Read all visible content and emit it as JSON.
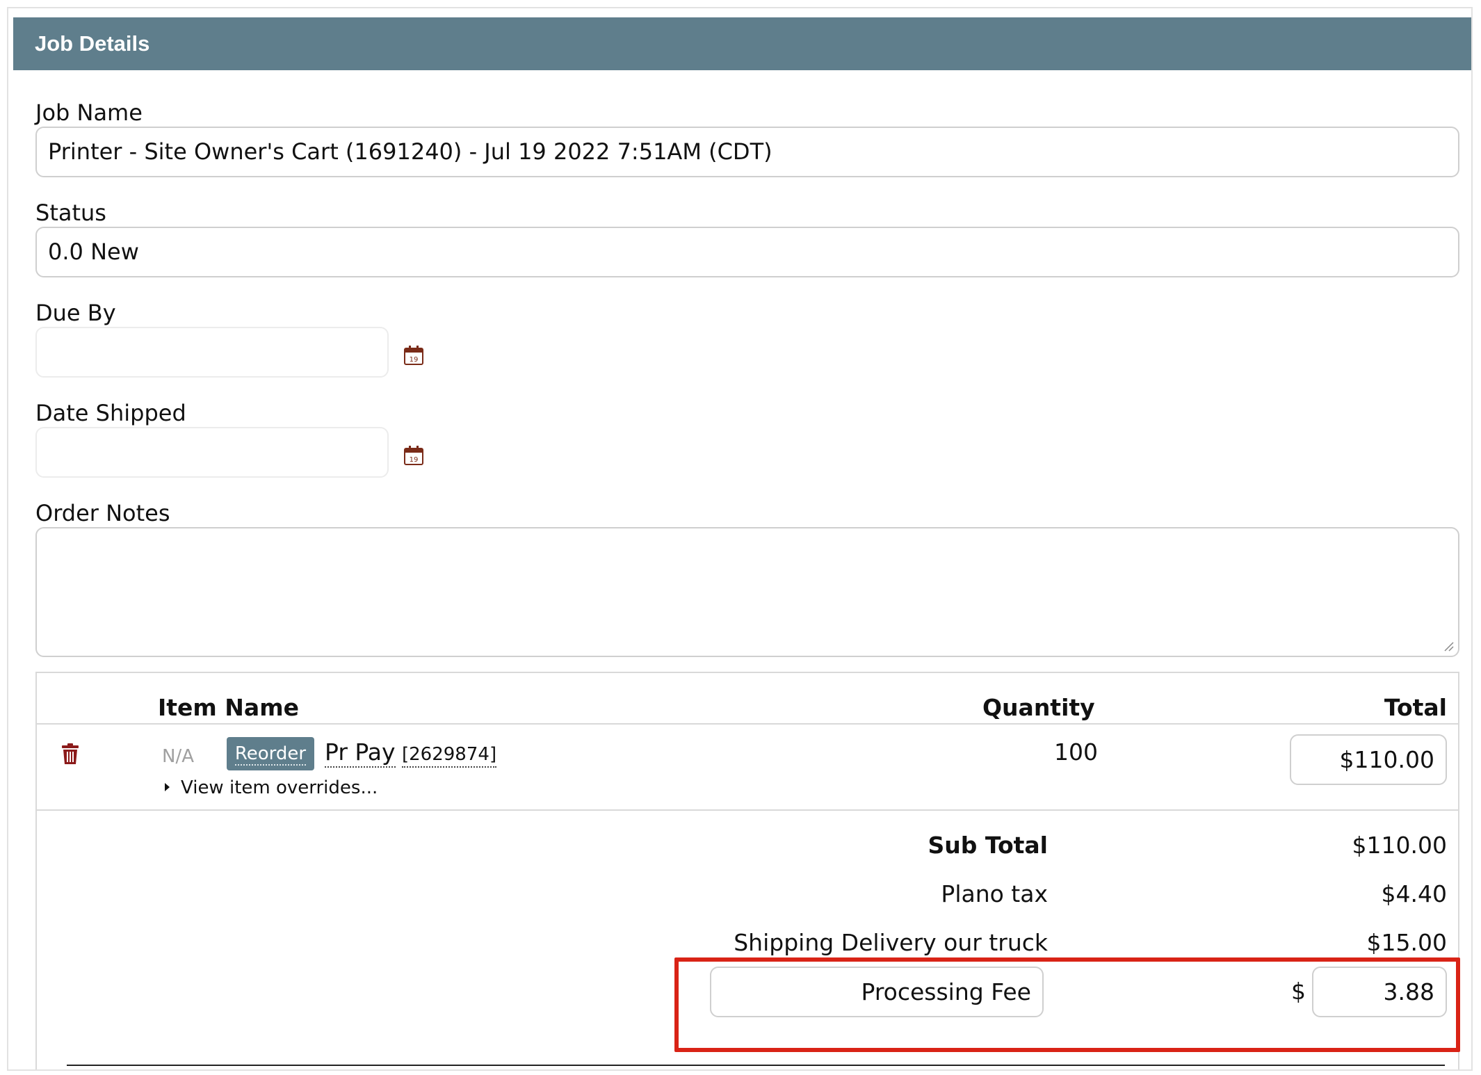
{
  "panel": {
    "title": "Job Details"
  },
  "fields": {
    "job_name": {
      "label": "Job Name",
      "value": "Printer - Site Owner's Cart (1691240) - Jul 19 2022  7:51AM (CDT)"
    },
    "status": {
      "label": "Status",
      "value": "0.0 New"
    },
    "due_by": {
      "label": "Due By",
      "value": "",
      "calendar_icon": "calendar-icon",
      "calendar_day": "19"
    },
    "date_shipped": {
      "label": "Date Shipped",
      "value": "",
      "calendar_icon": "calendar-icon",
      "calendar_day": "19"
    },
    "order_notes": {
      "label": "Order Notes",
      "value": ""
    }
  },
  "items_table": {
    "headers": {
      "item_name": "Item Name",
      "quantity": "Quantity",
      "total": "Total"
    },
    "rows": [
      {
        "delete_icon": "trash-icon",
        "na": "N/A",
        "reorder_label": "Reorder",
        "name": "Pr Pay",
        "id": "[2629874]",
        "overrides_label": "View item overrides...",
        "quantity": "100",
        "total": "$110.00"
      }
    ]
  },
  "summary": {
    "sub_total": {
      "label": "Sub Total",
      "value": "$110.00"
    },
    "tax": {
      "label": "Plano tax",
      "value": "$4.40"
    },
    "shipping": {
      "label": "Shipping Delivery our truck",
      "value": "$15.00"
    },
    "processing_fee": {
      "label": "Processing Fee",
      "currency": "$",
      "value": "3.88"
    }
  },
  "colors": {
    "header": "#5f7e8c",
    "highlight": "#d92316",
    "trash": "#8b1a1a"
  }
}
